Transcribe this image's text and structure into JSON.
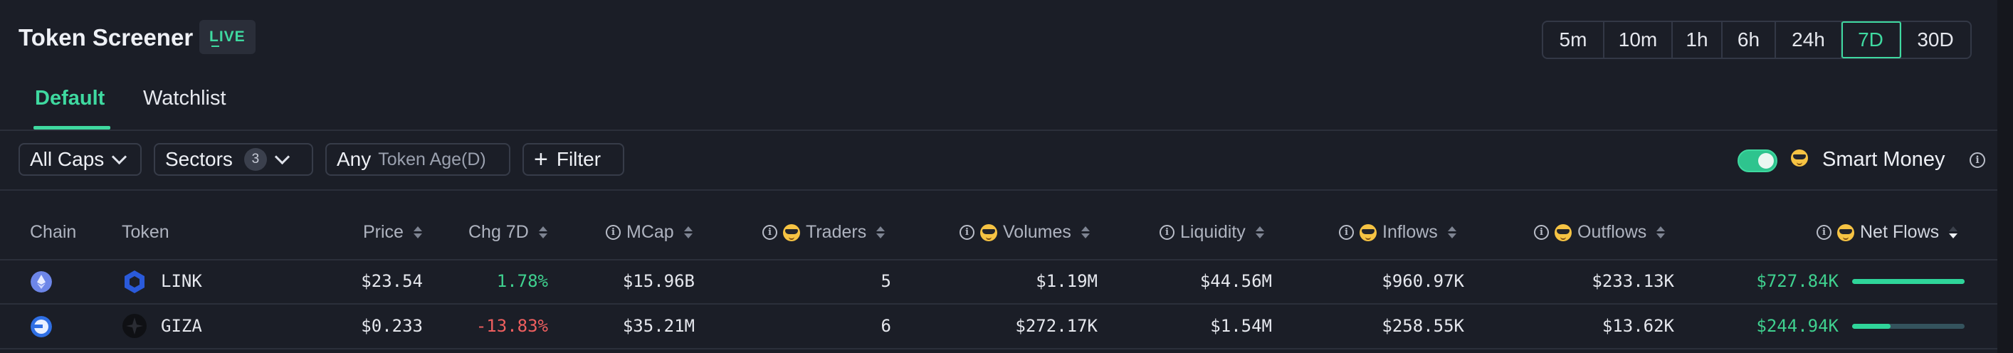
{
  "header": {
    "title": "Token Screener",
    "live_badge": "LIVE",
    "timeframes": [
      "5m",
      "10m",
      "1h",
      "6h",
      "24h",
      "7D",
      "30D"
    ],
    "active_timeframe": "7D"
  },
  "tabs": [
    {
      "label": "Default",
      "active": true
    },
    {
      "label": "Watchlist",
      "active": false
    }
  ],
  "filters": {
    "caps_label": "All Caps",
    "sectors_label": "Sectors",
    "sectors_count": "3",
    "age_value": "Any",
    "age_label": "Token Age(D)",
    "filter_label": "Filter",
    "smart_money_label": "Smart Money",
    "smart_money_enabled": true
  },
  "table": {
    "columns": {
      "chain": "Chain",
      "token": "Token",
      "price": "Price",
      "chg": "Chg 7D",
      "mcap": "MCap",
      "traders": "Traders",
      "volumes": "Volumes",
      "liquidity": "Liquidity",
      "inflows": "Inflows",
      "outflows": "Outflows",
      "netflows": "Net Flows"
    },
    "sorted_by": "Net Flows",
    "sort_direction": "desc",
    "rows": [
      {
        "chain_icon": "ethereum-icon",
        "token_icon": "chainlink-icon",
        "token": "LINK",
        "price": "$23.54",
        "chg": "1.78%",
        "chg_direction": "up",
        "mcap": "$15.96B",
        "traders": "5",
        "volumes": "$1.19M",
        "liquidity": "$44.56M",
        "inflows": "$960.97K",
        "outflows": "$233.13K",
        "netflows": "$727.84K",
        "netflow_bar_fraction": 1.0
      },
      {
        "chain_icon": "base-icon",
        "token_icon": "giza-icon",
        "token": "GIZA",
        "price": "$0.233",
        "chg": "-13.83%",
        "chg_direction": "down",
        "mcap": "$35.21M",
        "traders": "6",
        "volumes": "$272.17K",
        "liquidity": "$1.54M",
        "inflows": "$258.55K",
        "outflows": "$13.62K",
        "netflows": "$244.94K",
        "netflow_bar_fraction": 0.34
      }
    ]
  },
  "colors": {
    "accent": "#3fd9a0",
    "positive": "#3fd18f",
    "negative": "#ef5f5f",
    "background": "#1b1e27"
  }
}
